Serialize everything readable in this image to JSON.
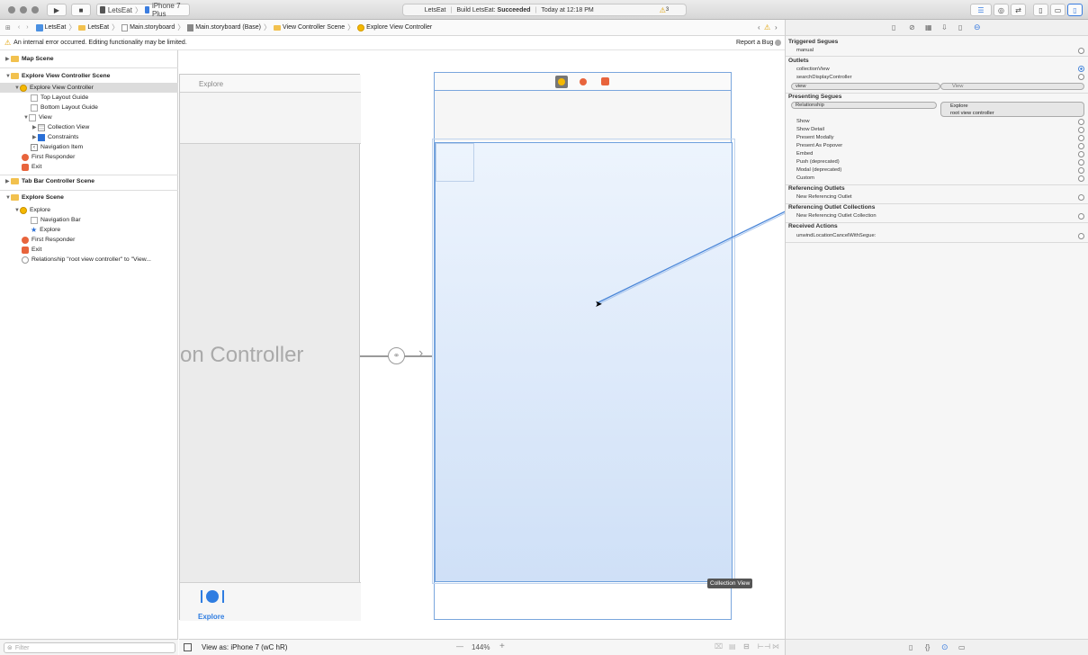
{
  "titlebar": {
    "scheme": "LetsEat",
    "device": "iPhone 7 Plus",
    "status_project": "LetsEat",
    "status_build_prefix": "Build LetsEat:",
    "status_build_result": "Succeeded",
    "status_time": "Today at 12:18 PM",
    "warning_count": "3"
  },
  "jumpbar": {
    "crumbs": [
      "LetsEat",
      "LetsEat",
      "Main.storyboard",
      "Main.storyboard (Base)",
      "View Controller Scene",
      "Explore View Controller"
    ]
  },
  "warning": {
    "message": "An internal error occurred. Editing functionality may be limited.",
    "report": "Report a Bug"
  },
  "outline": {
    "items": [
      "Map Scene",
      "Explore View Controller Scene",
      "Explore View Controller",
      "Top Layout Guide",
      "Bottom Layout Guide",
      "View",
      "Collection View",
      "Constraints",
      "Navigation Item",
      "First Responder",
      "Exit",
      "Tab Bar Controller Scene",
      "Explore Scene",
      "Explore",
      "Navigation Bar",
      "Explore",
      "First Responder",
      "Exit",
      "Relationship \"root view controller\" to \"View..."
    ],
    "filter_placeholder": "Filter"
  },
  "canvas": {
    "nav_title": "Explore",
    "controller_partial": "tion Controller",
    "tab_label": "Explore",
    "collection_tooltip": "Collection View"
  },
  "bottombar": {
    "view_as": "View as: iPhone 7 (wC hR)",
    "zoom": "144%",
    "minus": "—",
    "plus": "+"
  },
  "inspector": {
    "triggered_segues": "Triggered Segues",
    "manual": "manual",
    "outlets": "Outlets",
    "collectionView": "collectionView",
    "searchDisplayController": "searchDisplayController",
    "view": "view",
    "view_target": "View",
    "presenting_segues": "Presenting Segues",
    "relationship": "Relationship",
    "rel_target_1": "Explore",
    "rel_target_2": "root view controller",
    "segues": [
      "Show",
      "Show Detail",
      "Present Modally",
      "Present As Popover",
      "Embed",
      "Push (deprecated)",
      "Modal (deprecated)",
      "Custom"
    ],
    "referencing_outlets": "Referencing Outlets",
    "new_ref_outlet": "New Referencing Outlet",
    "referencing_outlet_collections": "Referencing Outlet Collections",
    "new_ref_outlet_collection": "New Referencing Outlet Collection",
    "received_actions": "Received Actions",
    "unwind": "unwindLocationCancelWithSegue:"
  }
}
